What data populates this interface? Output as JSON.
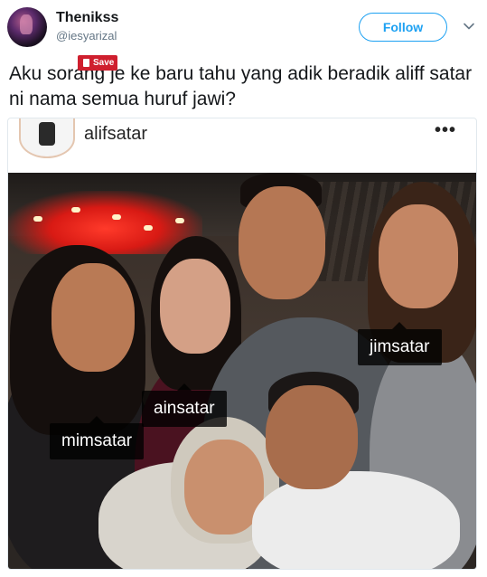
{
  "tweet": {
    "author": {
      "display_name": "Thenikss",
      "handle": "@iesyarizal"
    },
    "follow_label": "Follow",
    "text": "Aku sorang je ke baru tahu yang adik beradik aliff satar ni nama semua huruf jawi?",
    "save_badge": "Save"
  },
  "embed": {
    "username": "alifsatar",
    "more_icon": "more-horizontal-icon",
    "more_glyph": "•••",
    "photo_tags": [
      "jimsatar",
      "ainsatar",
      "mimsatar"
    ]
  },
  "colors": {
    "accent": "#1da1f2",
    "save_red": "#cf1f2e",
    "text": "#14171a",
    "secondary": "#657786"
  }
}
